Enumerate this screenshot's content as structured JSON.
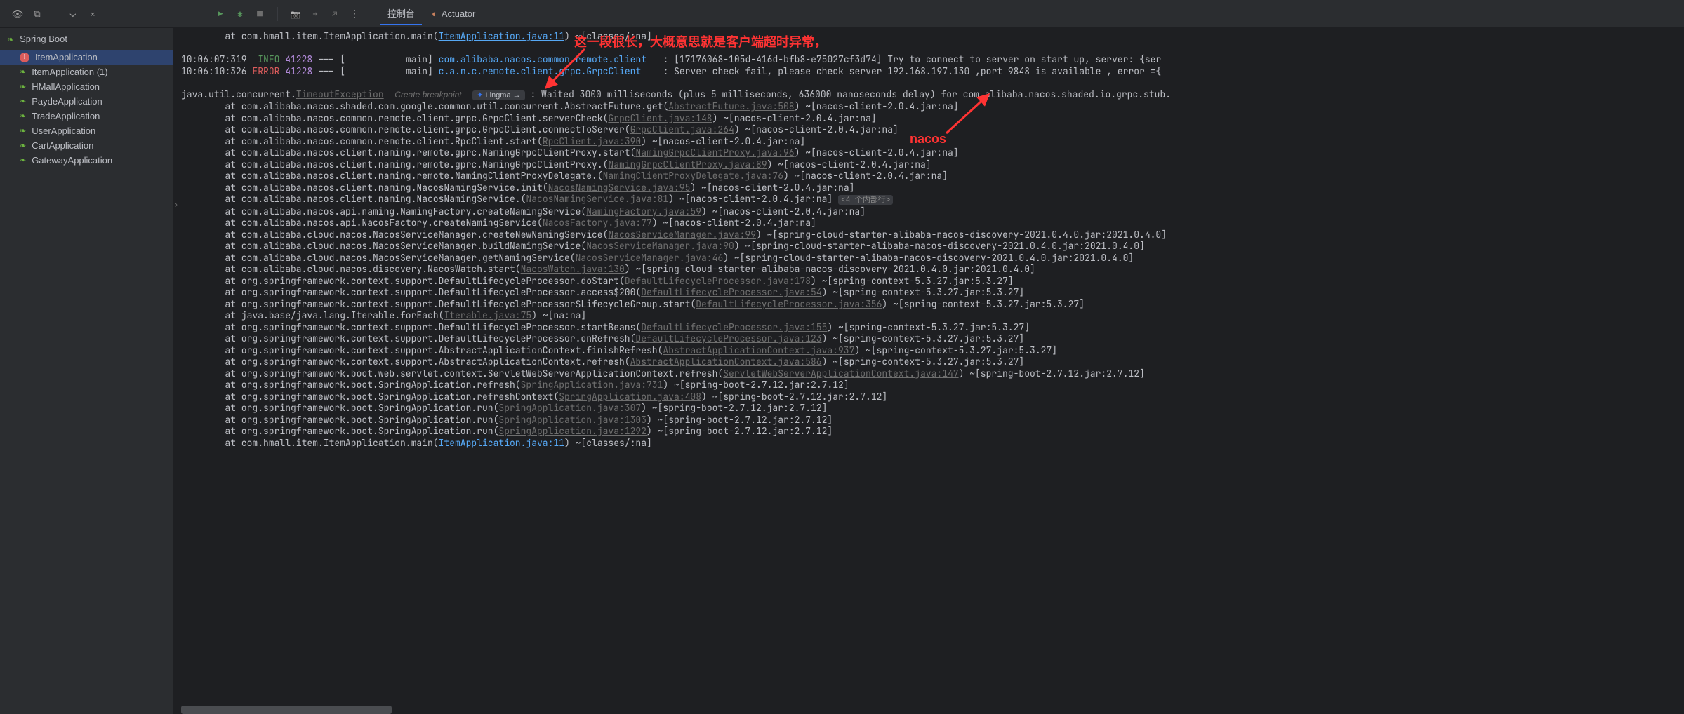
{
  "toolbar": {
    "tab_console": "控制台",
    "tab_actuator": "Actuator"
  },
  "sidebar": {
    "header": "Spring Boot",
    "items": [
      {
        "label": "ItemApplication",
        "has_error": true,
        "selected": true
      },
      {
        "label": "ItemApplication (1)"
      },
      {
        "label": "HMallApplication"
      },
      {
        "label": "PaydeApplication"
      },
      {
        "label": "TradeApplication"
      },
      {
        "label": "UserApplication"
      },
      {
        "label": "CartApplication"
      },
      {
        "label": "GatewayApplication"
      }
    ]
  },
  "annotations": {
    "note1": "这一段很长，大概意思就是客户端超时异常，",
    "note2": "nacos"
  },
  "log": {
    "line_top": "        at com.hmall.item.ItemApplication.main(",
    "line_top_link": "ItemApplication.java:11",
    "line_top_tail": ") ~[classes/:na]",
    "l1_time": "10:06:07:319",
    "l1_level": "INFO",
    "l1_pid": "41228",
    "l1_dash": " --- [",
    "l1_thread": "           main] ",
    "l1_logger": "com.alibaba.nacos.common.remote.client",
    "l1_tail": "   : [17176068-105d-416d-bfb8-e75027cf3d74] Try to connect to server on start up, server: {ser",
    "l2_time": "10:06:10:326",
    "l2_level": "ERROR",
    "l2_pid": "41228",
    "l2_dash": " --- [",
    "l2_thread": "           main] ",
    "l2_logger": "c.a.n.c.remote.client.grpc.GrpcClient",
    "l2_tail": "    : Server check fail, please check server 192.168.197.130 ,port 9848 is available , error ={",
    "ex_head": "java.util.concurrent.",
    "ex_link": "TimeoutException",
    "ex_break": "Create breakpoint",
    "ex_lingma_icon": "✦",
    "ex_lingma": "Lingma →",
    "ex_tail": " : Waited 3000 milliseconds (plus 5 milliseconds, 636000 nanoseconds delay) for com.alibaba.nacos.shaded.io.grpc.stub.",
    "fold_label": "<4 个内部行>",
    "trace": [
      {
        "pre": "        at com.alibaba.nacos.shaded.com.google.common.util.concurrent.AbstractFuture.get(",
        "link": "AbstractFuture.java:508",
        "post": ") ~[nacos-client-2.0.4.jar:na]"
      },
      {
        "pre": "        at com.alibaba.nacos.common.remote.client.grpc.GrpcClient.serverCheck(",
        "link": "GrpcClient.java:148",
        "post": ") ~[nacos-client-2.0.4.jar:na]"
      },
      {
        "pre": "        at com.alibaba.nacos.common.remote.client.grpc.GrpcClient.connectToServer(",
        "link": "GrpcClient.java:264",
        "post": ") ~[nacos-client-2.0.4.jar:na]"
      },
      {
        "pre": "        at com.alibaba.nacos.common.remote.client.RpcClient.start(",
        "link": "RpcClient.java:390",
        "post": ") ~[nacos-client-2.0.4.jar:na]"
      },
      {
        "pre": "        at com.alibaba.nacos.client.naming.remote.gprc.NamingGrpcClientProxy.start(",
        "link": "NamingGrpcClientProxy.java:96",
        "post": ") ~[nacos-client-2.0.4.jar:na]"
      },
      {
        "pre": "        at com.alibaba.nacos.client.naming.remote.gprc.NamingGrpcClientProxy.<init>(",
        "link": "NamingGrpcClientProxy.java:89",
        "post": ") ~[nacos-client-2.0.4.jar:na]"
      },
      {
        "pre": "        at com.alibaba.nacos.client.naming.remote.NamingClientProxyDelegate.<init>(",
        "link": "NamingClientProxyDelegate.java:76",
        "post": ") ~[nacos-client-2.0.4.jar:na]"
      },
      {
        "pre": "        at com.alibaba.nacos.client.naming.NacosNamingService.init(",
        "link": "NacosNamingService.java:95",
        "post": ") ~[nacos-client-2.0.4.jar:na]"
      },
      {
        "pre": "        at com.alibaba.nacos.client.naming.NacosNamingService.<init>(",
        "link": "NacosNamingService.java:81",
        "post": ") ~[nacos-client-2.0.4.jar:na]",
        "fold": true
      },
      {
        "pre": "        at com.alibaba.nacos.api.naming.NamingFactory.createNamingService(",
        "link": "NamingFactory.java:59",
        "post": ") ~[nacos-client-2.0.4.jar:na]"
      },
      {
        "pre": "        at com.alibaba.nacos.api.NacosFactory.createNamingService(",
        "link": "NacosFactory.java:77",
        "post": ") ~[nacos-client-2.0.4.jar:na]"
      },
      {
        "pre": "        at com.alibaba.cloud.nacos.NacosServiceManager.createNewNamingService(",
        "link": "NacosServiceManager.java:99",
        "post": ") ~[spring-cloud-starter-alibaba-nacos-discovery-2021.0.4.0.jar:2021.0.4.0]"
      },
      {
        "pre": "        at com.alibaba.cloud.nacos.NacosServiceManager.buildNamingService(",
        "link": "NacosServiceManager.java:90",
        "post": ") ~[spring-cloud-starter-alibaba-nacos-discovery-2021.0.4.0.jar:2021.0.4.0]"
      },
      {
        "pre": "        at com.alibaba.cloud.nacos.NacosServiceManager.getNamingService(",
        "link": "NacosServiceManager.java:46",
        "post": ") ~[spring-cloud-starter-alibaba-nacos-discovery-2021.0.4.0.jar:2021.0.4.0]"
      },
      {
        "pre": "        at com.alibaba.cloud.nacos.discovery.NacosWatch.start(",
        "link": "NacosWatch.java:130",
        "post": ") ~[spring-cloud-starter-alibaba-nacos-discovery-2021.0.4.0.jar:2021.0.4.0]"
      },
      {
        "pre": "        at org.springframework.context.support.DefaultLifecycleProcessor.doStart(",
        "link": "DefaultLifecycleProcessor.java:178",
        "post": ") ~[spring-context-5.3.27.jar:5.3.27]"
      },
      {
        "pre": "        at org.springframework.context.support.DefaultLifecycleProcessor.access$200(",
        "link": "DefaultLifecycleProcessor.java:54",
        "post": ") ~[spring-context-5.3.27.jar:5.3.27]"
      },
      {
        "pre": "        at org.springframework.context.support.DefaultLifecycleProcessor$LifecycleGroup.start(",
        "link": "DefaultLifecycleProcessor.java:356",
        "post": ") ~[spring-context-5.3.27.jar:5.3.27]"
      },
      {
        "pre": "        at java.base/java.lang.Iterable.forEach(",
        "link": "Iterable.java:75",
        "post": ") ~[na:na]"
      },
      {
        "pre": "        at org.springframework.context.support.DefaultLifecycleProcessor.startBeans(",
        "link": "DefaultLifecycleProcessor.java:155",
        "post": ") ~[spring-context-5.3.27.jar:5.3.27]"
      },
      {
        "pre": "        at org.springframework.context.support.DefaultLifecycleProcessor.onRefresh(",
        "link": "DefaultLifecycleProcessor.java:123",
        "post": ") ~[spring-context-5.3.27.jar:5.3.27]"
      },
      {
        "pre": "        at org.springframework.context.support.AbstractApplicationContext.finishRefresh(",
        "link": "AbstractApplicationContext.java:937",
        "post": ") ~[spring-context-5.3.27.jar:5.3.27]"
      },
      {
        "pre": "        at org.springframework.context.support.AbstractApplicationContext.refresh(",
        "link": "AbstractApplicationContext.java:586",
        "post": ") ~[spring-context-5.3.27.jar:5.3.27]"
      },
      {
        "pre": "        at org.springframework.boot.web.servlet.context.ServletWebServerApplicationContext.refresh(",
        "link": "ServletWebServerApplicationContext.java:147",
        "post": ") ~[spring-boot-2.7.12.jar:2.7.12]"
      },
      {
        "pre": "        at org.springframework.boot.SpringApplication.refresh(",
        "link": "SpringApplication.java:731",
        "post": ") ~[spring-boot-2.7.12.jar:2.7.12]"
      },
      {
        "pre": "        at org.springframework.boot.SpringApplication.refreshContext(",
        "link": "SpringApplication.java:408",
        "post": ") ~[spring-boot-2.7.12.jar:2.7.12]"
      },
      {
        "pre": "        at org.springframework.boot.SpringApplication.run(",
        "link": "SpringApplication.java:307",
        "post": ") ~[spring-boot-2.7.12.jar:2.7.12]"
      },
      {
        "pre": "        at org.springframework.boot.SpringApplication.run(",
        "link": "SpringApplication.java:1303",
        "post": ") ~[spring-boot-2.7.12.jar:2.7.12]"
      },
      {
        "pre": "        at org.springframework.boot.SpringApplication.run(",
        "link": "SpringApplication.java:1292",
        "post": ") ~[spring-boot-2.7.12.jar:2.7.12]"
      },
      {
        "pre": "        at com.hmall.item.ItemApplication.main(",
        "link": "ItemApplication.java:11",
        "post": ") ~[classes/:na]",
        "link_blue": true
      }
    ]
  }
}
